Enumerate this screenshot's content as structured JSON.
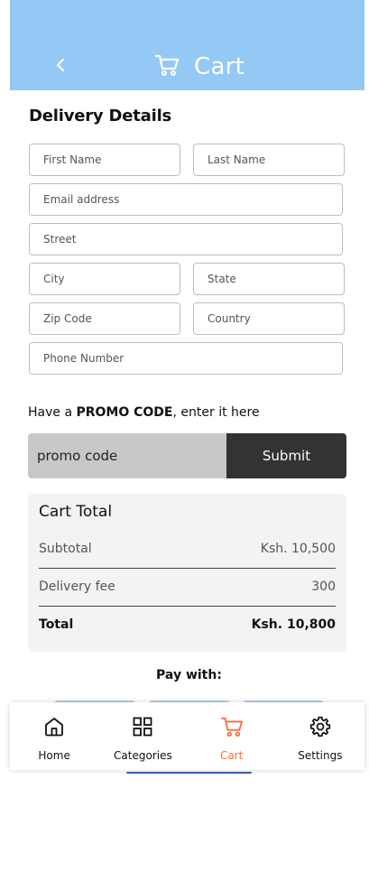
{
  "header": {
    "title": "Cart",
    "back_icon": "chevron-left-icon",
    "cart_icon": "cart-icon",
    "bg_color": "#94c9f5"
  },
  "delivery": {
    "title": "Delivery Details",
    "first_name_placeholder": "First Name",
    "last_name_placeholder": "Last Name",
    "email_placeholder": "Email address",
    "street_placeholder": "Street",
    "city_placeholder": "City",
    "state_placeholder": "State",
    "zip_placeholder": "Zip Code",
    "country_placeholder": "Country",
    "phone_placeholder": "Phone Number"
  },
  "promo": {
    "prefix": "Have a ",
    "emphasis": "PROMO CODE",
    "suffix": ", enter it here",
    "input_placeholder": "promo code",
    "submit_label": "Submit"
  },
  "cart_total": {
    "title": "Cart Total",
    "subtotal_label": "Subtotal",
    "subtotal_value": "Ksh. 10,500",
    "delivery_label": "Delivery fee",
    "delivery_value": "300",
    "total_label": "Total",
    "total_value": "Ksh. 10,800"
  },
  "payment": {
    "label": "Pay with:"
  },
  "nav": {
    "active_color": "#ff6a3d",
    "items": [
      {
        "label": "Home",
        "icon": "home-icon"
      },
      {
        "label": "Categories",
        "icon": "grid-icon"
      },
      {
        "label": "Cart",
        "icon": "cart-icon"
      },
      {
        "label": "Settings",
        "icon": "gear-icon"
      }
    ]
  }
}
